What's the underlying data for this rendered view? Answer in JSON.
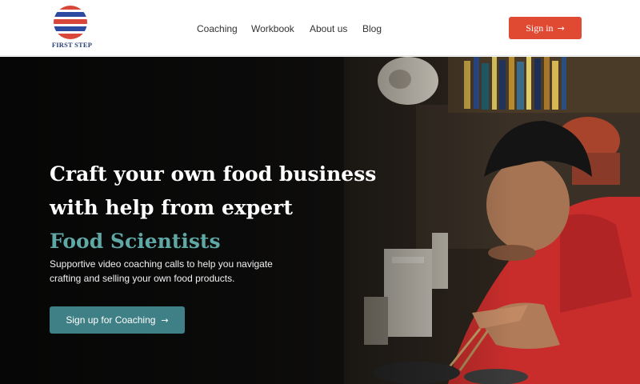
{
  "brand": {
    "name": "FIRST STEP",
    "logo_icon": "striped-globe-logo",
    "colors": {
      "red": "#d9463a",
      "blue": "#2c4aa0"
    }
  },
  "nav": {
    "links": [
      {
        "label": "Coaching"
      },
      {
        "label": "Workbook"
      },
      {
        "label": "About us"
      },
      {
        "label": "Blog"
      }
    ],
    "signin_label": "Sign in",
    "signin_icon": "arrow-right-icon"
  },
  "hero": {
    "headline_line1": "Craft your own food business",
    "headline_line2": "with help from expert",
    "headline_accent": "Food Scientists",
    "subtext": "Supportive video coaching calls to help you navigate crafting and selling your own food products.",
    "cta_label": "Sign up for Coaching",
    "cta_icon": "arrow-right-icon",
    "image_subject": "chef cooking in kitchen"
  },
  "colors": {
    "primary_red": "#e04a33",
    "teal_accent": "#5fa8a6",
    "teal_button": "#3f7f86",
    "nav_text": "#333333"
  }
}
